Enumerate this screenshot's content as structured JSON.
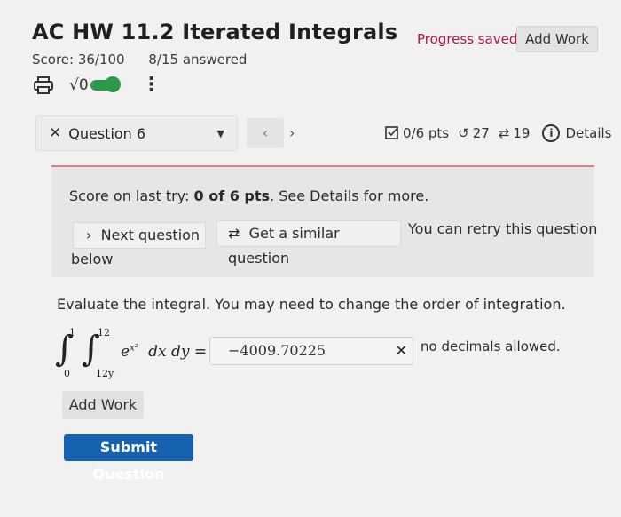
{
  "header": {
    "title": "AC HW 11.2 Iterated Integrals",
    "score": "Score: 36/100",
    "answered": "8/15 answered",
    "progress_status": "Progress saved",
    "add_work_label": "Add Work",
    "sqrt_label": "√0"
  },
  "question_bar": {
    "question_label": "Question 6",
    "prev_glyph": "‹",
    "next_glyph": "›",
    "points": "0/6 pts",
    "retries": "27",
    "similar_count": "19",
    "details_label": "Details"
  },
  "feedback": {
    "score_prefix": "Score on last try: ",
    "score_value": "0 of 6 pts",
    "score_suffix": ". See Details for more.",
    "next_question_label": "Next question",
    "similar_question_label": "Get a similar question",
    "retry_text": "You can retry this question",
    "retry_text_cont": "below"
  },
  "question": {
    "prompt": "Evaluate the integral. You may need to change the order of integration.",
    "outer_lower": "0",
    "outer_upper": "1",
    "inner_lower": "12y",
    "inner_upper": "12",
    "integrand": "e",
    "exponent": "x²",
    "differentials": "dx dy =",
    "answer_value": "−4009.70225",
    "error_message": "no decimals allowed."
  },
  "actions": {
    "add_work_label": "Add Work",
    "submit_label": "Submit Question"
  },
  "colors": {
    "progress_saved": "#b2124a",
    "submit": "#1662b0",
    "toggle": "#2a9a4a",
    "divider": "#d58383"
  }
}
